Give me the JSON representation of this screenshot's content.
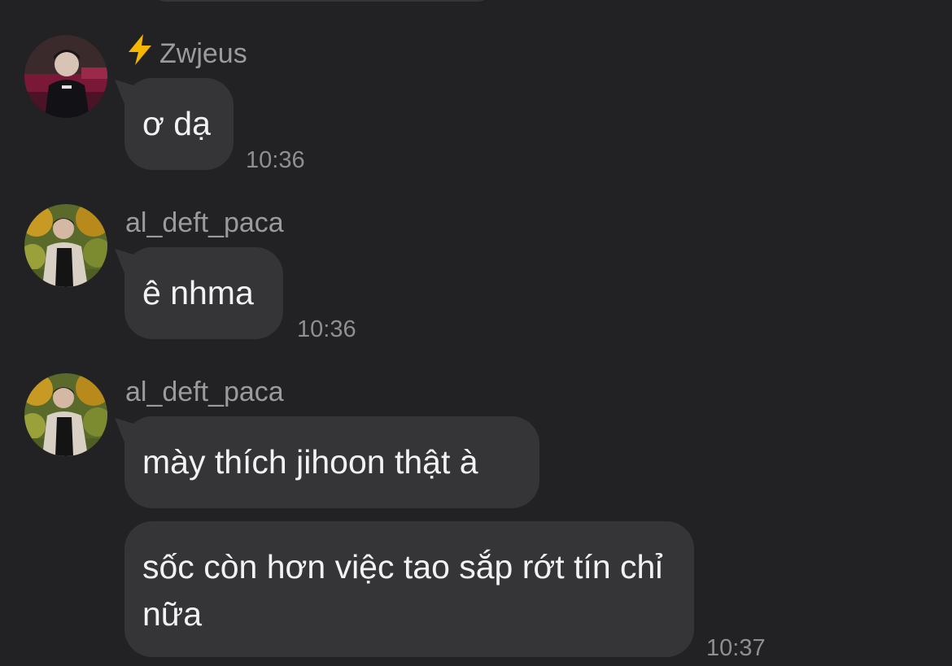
{
  "messages": [
    {
      "sender": "Zwjeus",
      "sender_icon": "lightning-bolt-icon",
      "avatar": "zwjeus-avatar",
      "text": "ơ dạ",
      "time": "10:36"
    },
    {
      "sender": "al_deft_paca",
      "avatar": "al_deft_paca-avatar",
      "text": "ê nhma",
      "time": "10:36"
    },
    {
      "sender": "al_deft_paca",
      "avatar": "al_deft_paca-avatar",
      "text": "mày thích jihoon thật à"
    },
    {
      "text": "sốc còn hơn việc tao sắp rớt tín chỉ nữa",
      "time": "10:37"
    }
  ],
  "colors": {
    "background": "#222224",
    "bubble": "#353537",
    "message_text": "#f2f2f4",
    "sender_name": "#9a9a9f",
    "timestamp": "#8e8e93",
    "bolt": "#f5b700"
  }
}
